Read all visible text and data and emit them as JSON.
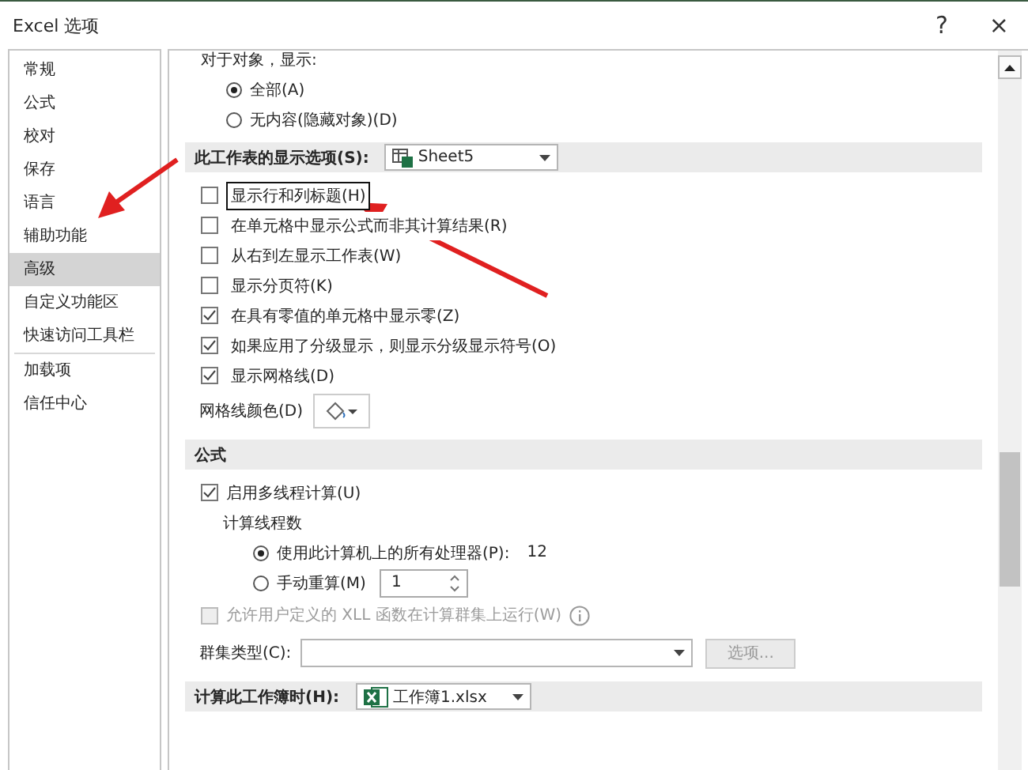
{
  "window": {
    "title": "Excel 选项",
    "help": "?",
    "close": "×"
  },
  "sidebar": {
    "groups": [
      {
        "items": [
          {
            "label": "常规",
            "selected": false
          },
          {
            "label": "公式",
            "selected": false
          },
          {
            "label": "校对",
            "selected": false
          },
          {
            "label": "保存",
            "selected": false
          },
          {
            "label": "语言",
            "selected": false
          },
          {
            "label": "辅助功能",
            "selected": false
          },
          {
            "label": "高级",
            "selected": true
          },
          {
            "label": "自定义功能区",
            "selected": false
          },
          {
            "label": "快速访问工具栏",
            "selected": false
          }
        ]
      },
      {
        "items": [
          {
            "label": "加载项",
            "selected": false
          },
          {
            "label": "信任中心",
            "selected": false
          }
        ]
      }
    ]
  },
  "objects": {
    "label": "对于对象，显示:",
    "options": [
      {
        "label": "全部(A)",
        "selected": true
      },
      {
        "label": "无内容(隐藏对象)(D)",
        "selected": false
      }
    ]
  },
  "sheet_section": {
    "label": "此工作表的显示选项(S):",
    "dropdown": "Sheet5",
    "options": [
      {
        "label": "显示行和列标题(H)",
        "checked": false,
        "highlighted": true
      },
      {
        "label": "在单元格中显示公式而非其计算结果(R)",
        "checked": false,
        "highlighted": false
      },
      {
        "label": "从右到左显示工作表(W)",
        "checked": false,
        "highlighted": false
      },
      {
        "label": "显示分页符(K)",
        "checked": false,
        "highlighted": false
      },
      {
        "label": "在具有零值的单元格中显示零(Z)",
        "checked": true,
        "highlighted": false
      },
      {
        "label": "如果应用了分级显示，则显示分级显示符号(O)",
        "checked": true,
        "highlighted": false
      },
      {
        "label": "显示网格线(D)",
        "checked": true,
        "highlighted": false
      }
    ],
    "gridline_color_label": "网格线颜色(D)"
  },
  "formula_section": {
    "title": "公式",
    "multithread": {
      "label": "启用多线程计算(U)",
      "checked": true
    },
    "threads_label": "计算线程数",
    "thread_options": [
      {
        "label": "使用此计算机上的所有处理器(P):",
        "selected": true,
        "reading": "12"
      },
      {
        "label": "手动重算(M)",
        "selected": false,
        "spinner": "1"
      }
    ],
    "xll": {
      "label": "允许用户定义的 XLL 函数在计算群集上运行(W)",
      "checked": false,
      "disabled": true
    },
    "cluster_label": "群集类型(C):",
    "options_button": {
      "label": "选项...",
      "disabled": true
    }
  },
  "workbook_section": {
    "label": "计算此工作簿时(H):",
    "dropdown": "工作簿1.xlsx"
  }
}
